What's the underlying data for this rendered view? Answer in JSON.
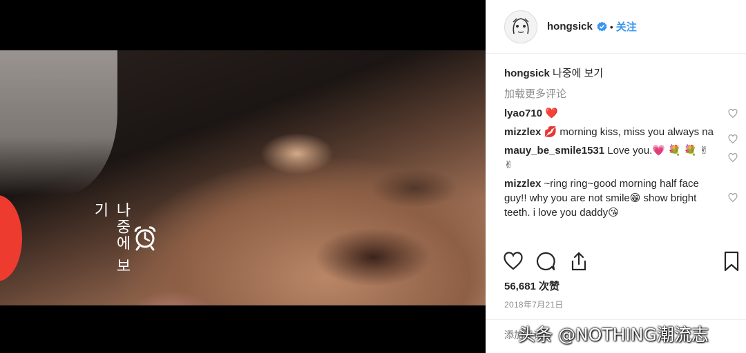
{
  "media": {
    "reminder_text": "나중에 보기"
  },
  "post": {
    "username": "hongsick",
    "follow_label": "关注",
    "separator": "•",
    "caption_username": "hongsick",
    "caption_text": "나중에 보기",
    "load_more": "加载更多评论",
    "comments": [
      {
        "user": "lyao710",
        "text": "❤️"
      },
      {
        "user": "mizzlex",
        "text": "💋 morning kiss, miss you always na"
      },
      {
        "user": "mauy_be_smile1531",
        "text": "Love you.💗 💐 💐 ✌ ✌"
      },
      {
        "user": "mizzlex",
        "text": "~ring ring~good morning half face guy!! why you are not smile😁 show bright teeth. i love you daddy😘"
      }
    ],
    "likes": "56,681 次赞",
    "date": "2018年7月21日",
    "comment_placeholder": "添加评论..."
  },
  "watermark": "头条 @NOTHING潮流志",
  "colors": {
    "accent": "#3897f0",
    "record": "#ee3b30",
    "heart": "#ed4956"
  },
  "icons": [
    "alarm-clock-icon",
    "verified-badge-icon",
    "heart-icon",
    "comment-icon",
    "share-icon",
    "bookmark-icon"
  ]
}
